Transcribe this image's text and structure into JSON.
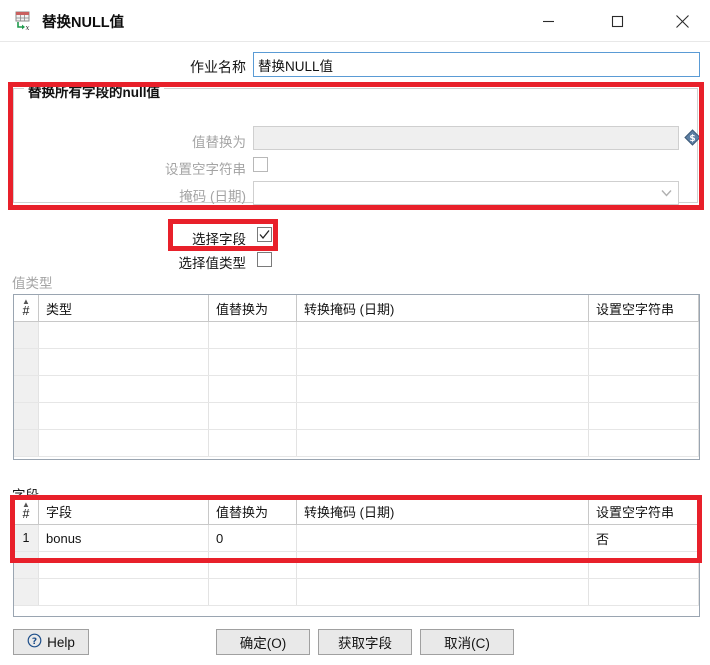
{
  "window": {
    "title": "替换NULL值",
    "icon": "replace-null-table-icon",
    "controls": {
      "minimize": "minimize-icon",
      "maximize": "maximize-icon",
      "close": "close-icon"
    }
  },
  "job": {
    "label": "作业名称",
    "value": "替换NULL值",
    "placeholder": ""
  },
  "group": {
    "title": "替换所有字段的null值",
    "value_replace_label": "值替换为",
    "value_replace_value": "",
    "value_replace_placeholder": "",
    "variable_icon": "variable-diamond-icon",
    "empty_string_label": "设置空字符串",
    "empty_string_checked": false,
    "mask_label": "掩码 (日期)",
    "mask_value": "",
    "mask_arrow_icon": "chevron-down-icon"
  },
  "options": {
    "select_field_label": "选择字段",
    "select_field_checked": true,
    "select_value_type_label": "选择值类型",
    "select_value_type_checked": false,
    "check_icon": "check-icon"
  },
  "value_type_section": {
    "label": "值类型",
    "columns": [
      "#",
      "类型",
      "值替换为",
      "转换掩码 (日期)",
      "设置空字符串",
      ""
    ],
    "rows": [],
    "empty_row_count": 5
  },
  "fields_section": {
    "label": "字段",
    "columns": [
      "#",
      "字段",
      "值替换为",
      "转换掩码 (日期)",
      "设置空字符串",
      ""
    ],
    "rows": [
      {
        "num": "1",
        "field": "bonus",
        "replace_with": "0",
        "mask": "",
        "empty_string": "否",
        "extra": ""
      }
    ],
    "empty_row_count": 2
  },
  "buttons": {
    "help": "Help",
    "help_icon": "question-circle-icon",
    "ok": "确定(O)",
    "get_fields": "获取字段",
    "cancel": "取消(C)"
  },
  "colors": {
    "annotation": "#e8202a",
    "focus_border": "#5a9bd5",
    "disabled_text": "#a4a4a4"
  }
}
